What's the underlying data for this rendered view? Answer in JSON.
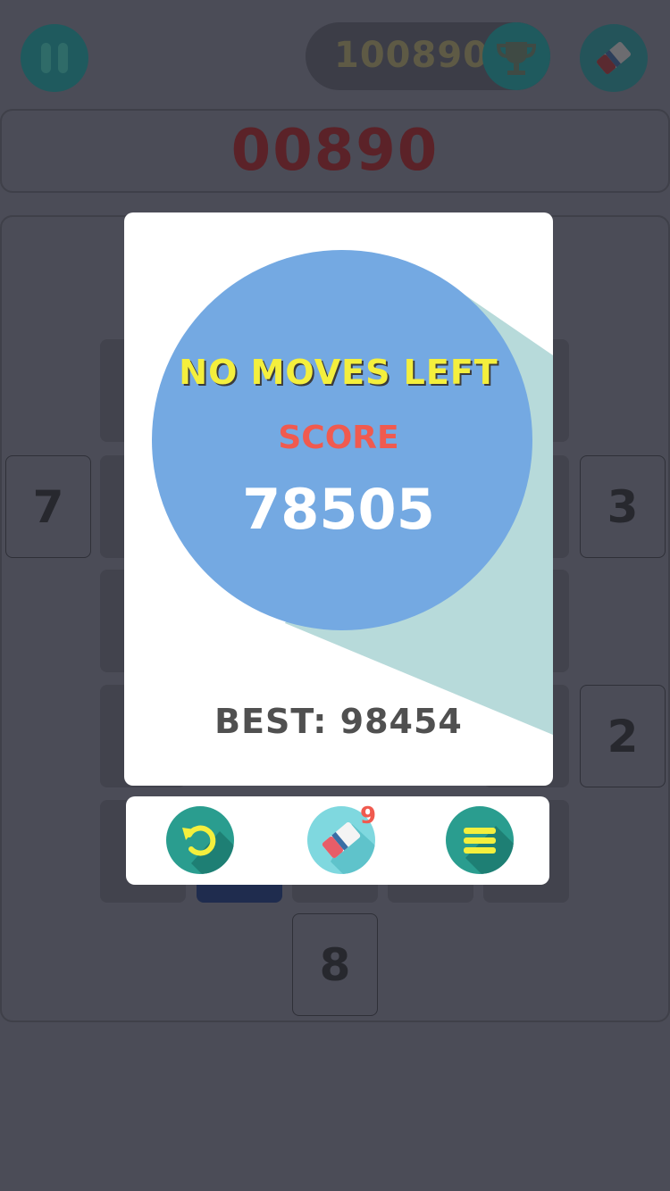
{
  "header": {
    "best_total": "100890",
    "current_score": "00890",
    "icons": {
      "pause": "pause-icon",
      "trophy": "trophy-icon",
      "eraser": "eraser-icon"
    }
  },
  "board": {
    "side_tiles": {
      "left": "7",
      "right_top": "3",
      "right_bottom": "2",
      "bottom": "8"
    }
  },
  "modal": {
    "title": "NO MOVES LEFT",
    "score_label": "SCORE",
    "score_value": "78505",
    "best_text": "BEST: 98454"
  },
  "actions": {
    "eraser_count": "9",
    "icons": {
      "restart": "restart-icon",
      "eraser": "eraser-icon",
      "menu": "menu-icon"
    }
  },
  "colors": {
    "overlay": "#4b4c57",
    "circle_blue": "#74a9e2",
    "title_yellow": "#f4ef3d",
    "score_red": "#f05a4f",
    "teal_button": "#2a9d8f"
  }
}
